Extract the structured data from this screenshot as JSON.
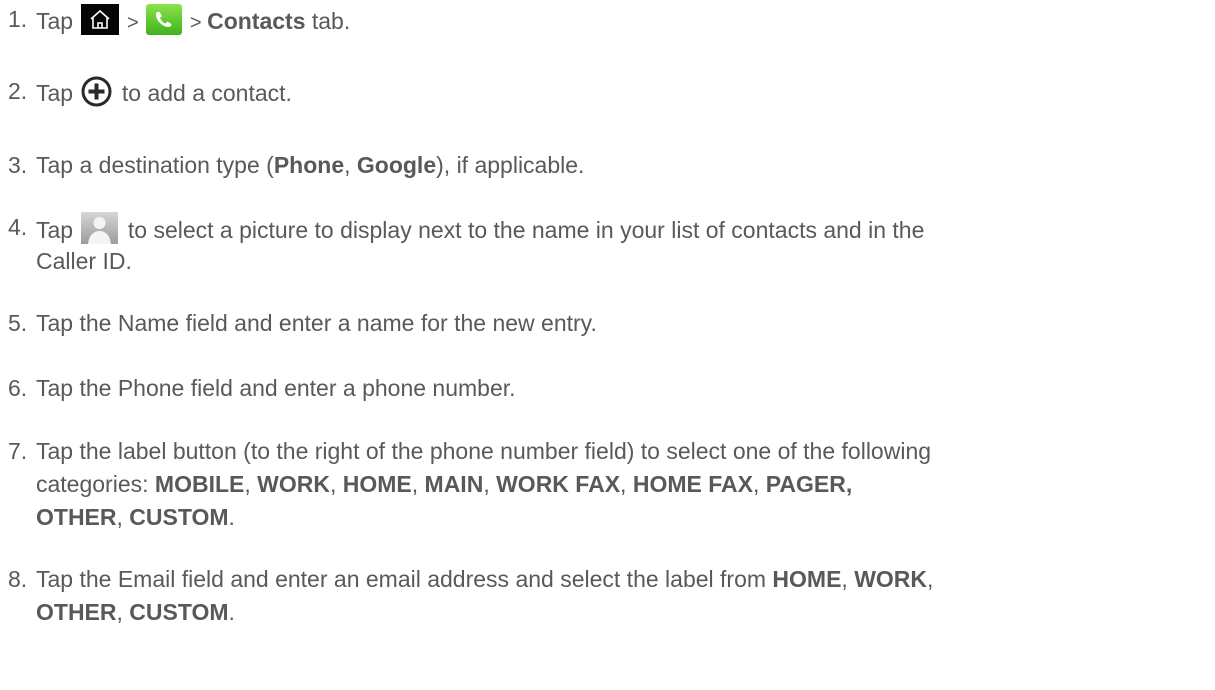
{
  "steps": [
    {
      "n": "1.",
      "parts": [
        "Tap ",
        " > ",
        " > ",
        "Contacts",
        " tab."
      ],
      "icons": [
        "home-icon",
        "phone-icon"
      ]
    },
    {
      "n": "2.",
      "parts": [
        "Tap ",
        " to add a contact."
      ],
      "icons": [
        "add-icon"
      ]
    },
    {
      "n": "3.",
      "parts": [
        "Tap a destination type (",
        "Phone",
        ", ",
        "Google",
        "), if applicable."
      ]
    },
    {
      "n": "4.",
      "parts": [
        "Tap ",
        " to select a picture to display next to the name in your list of contacts and in the",
        "Caller ID."
      ],
      "icons": [
        "contact-picture-icon"
      ]
    },
    {
      "n": "5.",
      "text": "Tap the Name field and enter a name for the new entry."
    },
    {
      "n": "6.",
      "text": "Tap the Phone field and enter a phone number."
    },
    {
      "n": "7.",
      "parts": [
        "Tap the label button (to the right of the phone number field) to select one of the following",
        "categories: ",
        "MOBILE",
        ", ",
        "WORK",
        ", ",
        "HOME",
        ", ",
        "MAIN",
        ", ",
        "WORK FAX",
        ", ",
        "HOME FAX",
        ", ",
        "PAGER,",
        "OTHER",
        ", ",
        "CUSTOM",
        "."
      ]
    },
    {
      "n": "8.",
      "parts": [
        "Tap the Email field and enter an email address and select the label from ",
        "HOME",
        ", ",
        "WORK",
        ",",
        "OTHER",
        ", ",
        "CUSTOM",
        "."
      ]
    }
  ],
  "icon_colors": {
    "phone": "#4cc222",
    "home_bg": "#050505",
    "plus": "#2a2a2a",
    "person": "#9b9b9b"
  }
}
